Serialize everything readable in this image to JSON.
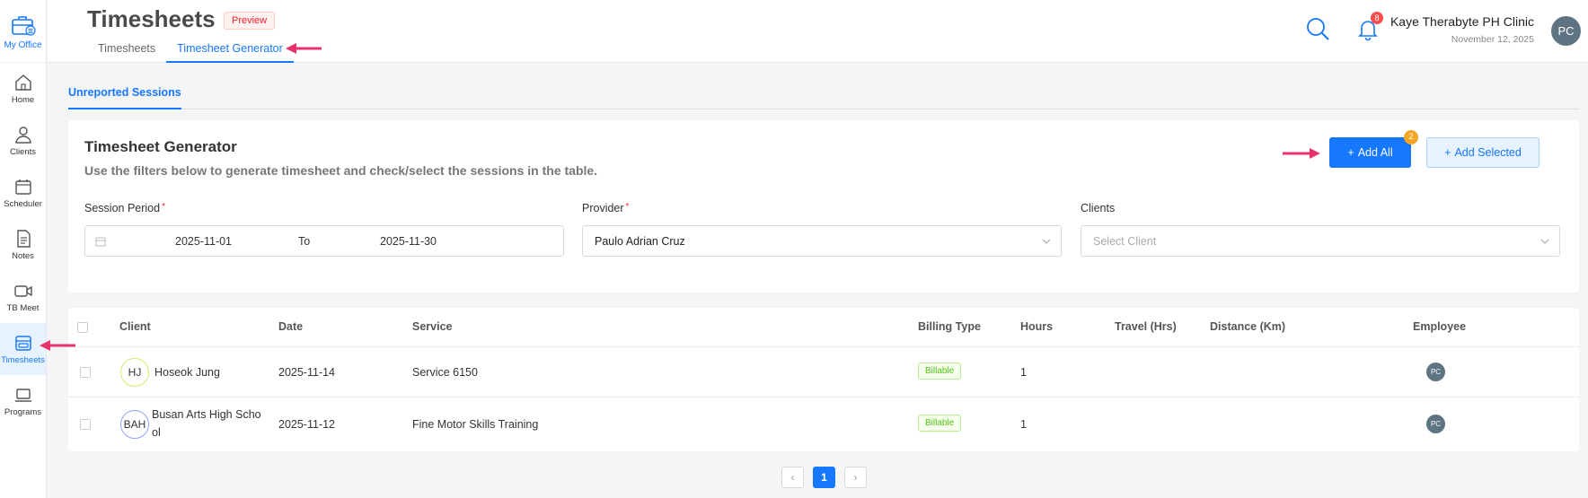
{
  "sidebar": {
    "brand_label": "My Office",
    "items": [
      {
        "label": "Home"
      },
      {
        "label": "Clients"
      },
      {
        "label": "Scheduler"
      },
      {
        "label": "Notes"
      },
      {
        "label": "TB Meet"
      },
      {
        "label": "Timesheets",
        "active": true
      },
      {
        "label": "Programs"
      }
    ]
  },
  "header": {
    "title": "Timesheets",
    "badge": "Preview",
    "tabs": [
      {
        "label": "Timesheets",
        "active": false
      },
      {
        "label": "Timesheet Generator",
        "active": true
      }
    ],
    "notification_count": "8",
    "org_name": "Kaye Therabyte PH Clinic",
    "date": "November 12, 2025",
    "avatar_initials": "PC"
  },
  "subtab": {
    "label": "Unreported Sessions"
  },
  "generator": {
    "title": "Timesheet Generator",
    "subtitle": "Use the filters below to generate timesheet and check/select the sessions in the table.",
    "add_all_label": "Add All",
    "add_all_count": "2",
    "add_selected_label": "Add Selected",
    "session_period_label": "Session Period",
    "required_mark": "*",
    "date_start": "2025-11-01",
    "date_to": "To",
    "date_end": "2025-11-30",
    "provider_label": "Provider",
    "provider_value": "Paulo Adrian Cruz",
    "clients_label": "Clients",
    "clients_placeholder": "Select Client"
  },
  "table": {
    "columns": {
      "client": "Client",
      "date": "Date",
      "service": "Service",
      "billing_type": "Billing Type",
      "hours": "Hours",
      "travel": "Travel (Hrs)",
      "distance": "Distance (Km)",
      "employee": "Employee"
    },
    "rows": [
      {
        "initials": "HJ",
        "client_line1": "Hoseok Jung",
        "client_line2": "",
        "date": "2025-11-14",
        "service": "Service 6150",
        "billing_type": "Billable",
        "hours": "1",
        "employee_initials": "PC",
        "avatar_color": "#d4e86a"
      },
      {
        "initials": "BAH",
        "client_line1": "Busan Arts High Scho",
        "client_line2": "ol",
        "date": "2025-11-12",
        "service": "Fine Motor Skills Training",
        "billing_type": "Billable",
        "hours": "1",
        "employee_initials": "PC",
        "avatar_color": "#8ea2ff"
      }
    ]
  },
  "pagination": {
    "prev": "‹",
    "current": "1",
    "next": "›"
  },
  "colors": {
    "accent": "#1677ff",
    "annotation": "#e8326b"
  }
}
